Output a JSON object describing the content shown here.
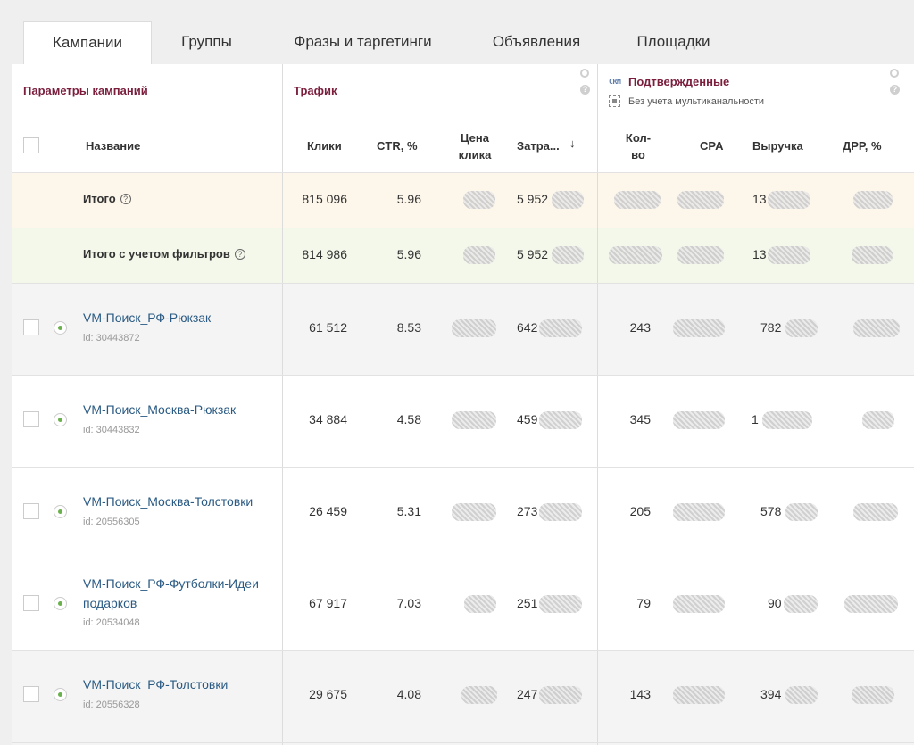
{
  "tabs": [
    {
      "label": "Кампании",
      "active": true
    },
    {
      "label": "Группы",
      "active": false
    },
    {
      "label": "Фразы и таргетинги",
      "active": false
    },
    {
      "label": "Объявления",
      "active": false
    },
    {
      "label": "Площадки",
      "active": false
    }
  ],
  "groups": {
    "params": "Параметры кампаний",
    "traffic": "Трафик",
    "confirmed": "Подтвержденные",
    "crm_badge": "CRM",
    "confirmed_sub": "Без учета мультиканальности"
  },
  "columns": {
    "name": "Название",
    "clicks": "Клики",
    "ctr": "CTR, %",
    "price_line1": "Цена",
    "price_line2": "клика",
    "spend": "Затра...",
    "count_line1": "Кол-",
    "count_line2": "во",
    "cpa": "CPA",
    "revenue": "Выручка",
    "drr": "ДРР, %"
  },
  "totals": [
    {
      "label": "Итого",
      "clicks": "815 096",
      "ctr": "5.96",
      "spend_prefix": "5 952",
      "revenue_prefix": "13"
    },
    {
      "label": "Итого с учетом фильтров",
      "clicks": "814 986",
      "ctr": "5.96",
      "spend_prefix": "5 952",
      "revenue_prefix": "13"
    }
  ],
  "campaigns": [
    {
      "name_line1": "VM-Поиск_РФ-Рюкзак",
      "name_line2": "",
      "id": "id: 30443872",
      "clicks": "61 512",
      "ctr": "8.53",
      "spend_prefix": "642",
      "count": "243",
      "revenue_prefix": "782"
    },
    {
      "name_line1": "VM-Поиск_Москва-Рюкзак",
      "name_line2": "",
      "id": "id: 30443832",
      "clicks": "34 884",
      "ctr": "4.58",
      "spend_prefix": "459",
      "count": "345",
      "revenue_prefix": "1"
    },
    {
      "name_line1": "VM-Поиск_Москва-Толстовки",
      "name_line2": "",
      "id": "id: 20556305",
      "clicks": "26 459",
      "ctr": "5.31",
      "spend_prefix": "273",
      "count": "205",
      "revenue_prefix": "578"
    },
    {
      "name_line1": "VM-Поиск_РФ-Футболки-Идеи",
      "name_line2": "подарков",
      "id": "id: 20534048",
      "clicks": "67 917",
      "ctr": "7.03",
      "spend_prefix": "251",
      "count": "79",
      "revenue_prefix": "90"
    },
    {
      "name_line1": "VM-Поиск_РФ-Толстовки",
      "name_line2": "",
      "id": "id: 20556328",
      "clicks": "29 675",
      "ctr": "4.08",
      "spend_prefix": "247",
      "count": "143",
      "revenue_prefix": "394"
    }
  ],
  "colors": {
    "accent": "#7a1e3c",
    "link": "#2b5b84",
    "total_bg": "#fdf6ea",
    "filtered_bg": "#f3f8ea",
    "row_alt_bg": "#f4f4f4"
  }
}
